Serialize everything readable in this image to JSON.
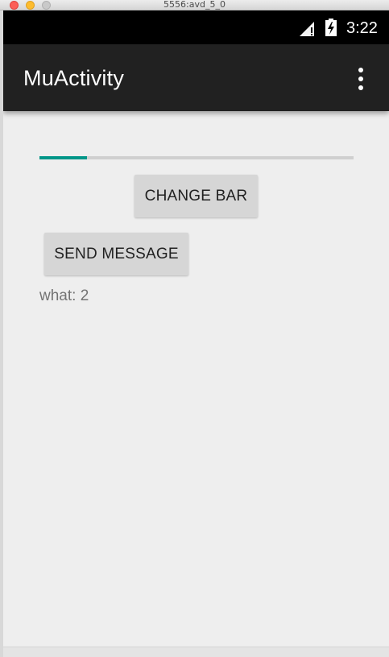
{
  "window": {
    "title": "5556:avd_5_0"
  },
  "status_bar": {
    "time": "3:22",
    "icons": [
      "signal-icon",
      "battery-charging-icon"
    ]
  },
  "app_bar": {
    "title": "MuActivity",
    "menu_icon": "overflow-menu-icon"
  },
  "progress": {
    "value_fraction": 0.15,
    "color": "#009688",
    "track_color": "#cfcfcf"
  },
  "buttons": {
    "change_bar": "CHANGE BAR",
    "send_message": "SEND MESSAGE"
  },
  "message_text": "what: 2",
  "colors": {
    "app_bar": "#212121",
    "background": "#eeeeee",
    "accent": "#009688"
  }
}
